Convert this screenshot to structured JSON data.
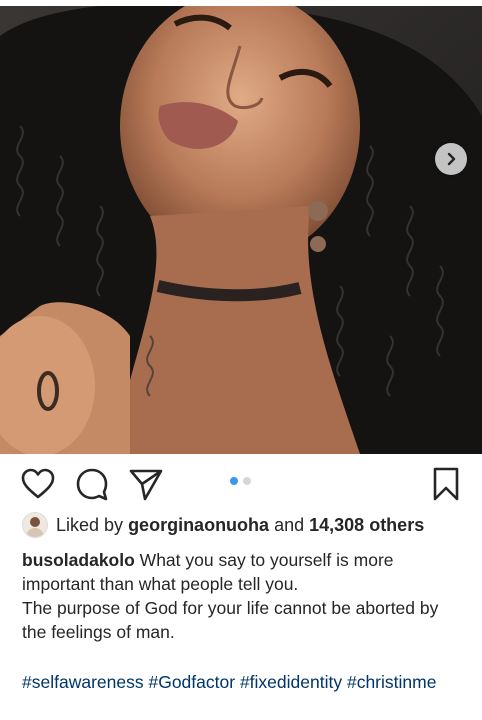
{
  "post": {
    "image_alt": "Selfie of a woman with long dark curly hair and a choker necklace",
    "carousel": {
      "total": 2,
      "current": 1
    },
    "actions": {
      "like_icon": "heart-outline-icon",
      "comment_icon": "comment-bubble-icon",
      "share_icon": "paper-plane-icon",
      "save_icon": "bookmark-icon",
      "next_icon": "chevron-right-icon"
    },
    "likes": {
      "prefix": "Liked by",
      "user": "georginaonuoha",
      "joiner": "and",
      "count_text": "14,308 others"
    },
    "caption": {
      "username": "busoladakolo",
      "line1": "What you say to yourself is more important than what people tell you.",
      "line2": "The purpose of God for your life cannot be aborted by the feelings of man."
    },
    "hashtags": [
      "#selfawareness",
      "#Godfactor",
      "#fixedidentity",
      "#christinme"
    ]
  },
  "colors": {
    "link": "#003569",
    "active_dot": "#3897f0",
    "inactive_dot": "#d6d6d6",
    "text": "#262626"
  }
}
